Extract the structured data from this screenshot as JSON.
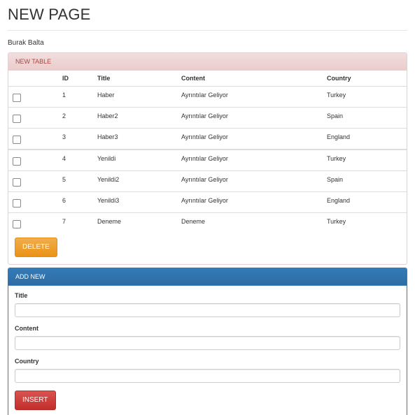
{
  "page": {
    "title": "NEW PAGE",
    "author": "Burak Balta"
  },
  "table_panel": {
    "heading": "NEW TABLE",
    "columns": [
      "ID",
      "Title",
      "Content",
      "Country"
    ],
    "rows": [
      {
        "id": "1",
        "title": "Haber",
        "content": "Ayrıntılar Geliyor",
        "country": "Turkey"
      },
      {
        "id": "2",
        "title": "Haber2",
        "content": "Ayrıntılar Geliyor",
        "country": "Spain"
      },
      {
        "id": "3",
        "title": "Haber3",
        "content": "Ayrıntılar Geliyor",
        "country": "England"
      },
      {
        "id": "4",
        "title": "Yenildi",
        "content": "Ayrıntılar Geliyor",
        "country": "Turkey"
      },
      {
        "id": "5",
        "title": "Yenildi2",
        "content": "Ayrıntılar Geliyor",
        "country": "Spain"
      },
      {
        "id": "6",
        "title": "Yenildi3",
        "content": "Ayrıntılar Geliyor",
        "country": "England"
      },
      {
        "id": "7",
        "title": "Deneme",
        "content": "Deneme",
        "country": "Turkey"
      }
    ],
    "delete_label": "DELETE"
  },
  "form_panel": {
    "heading": "ADD NEW",
    "fields": {
      "title": {
        "label": "Title",
        "value": "",
        "placeholder": ""
      },
      "content": {
        "label": "Content",
        "value": "",
        "placeholder": ""
      },
      "country": {
        "label": "Country",
        "value": "",
        "placeholder": ""
      }
    },
    "insert_label": "INSERT"
  },
  "colors": {
    "danger_heading_bg": "#f2dede",
    "danger_heading_text": "#a94442",
    "primary": "#337ab7",
    "warning_button": "#f0ad4e",
    "danger_button": "#d9534f"
  }
}
